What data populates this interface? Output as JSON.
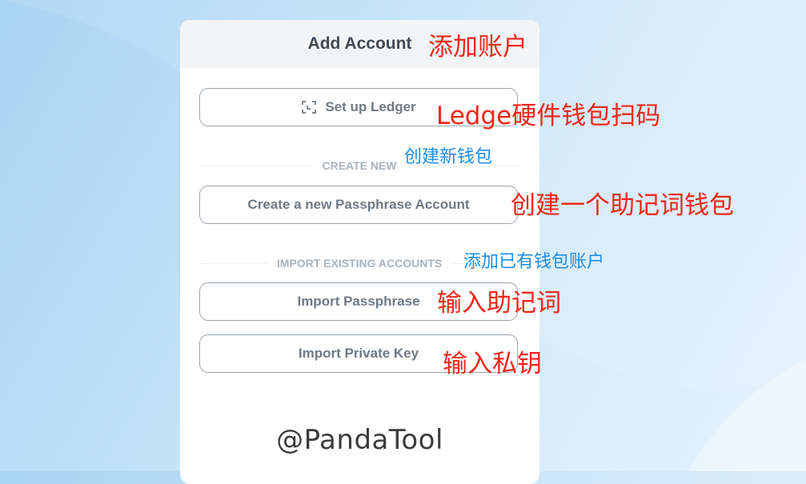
{
  "card": {
    "title": "Add Account"
  },
  "ledger_button": {
    "label": "Set up Ledger",
    "icon": "scan-icon"
  },
  "create_section": {
    "label": "CREATE NEW",
    "button_label": "Create a new Passphrase Account"
  },
  "import_section": {
    "label": "IMPORT EXISTING ACCOUNTS",
    "passphrase_label": "Import Passphrase",
    "private_key_label": "Import Private Key"
  },
  "watermark": "@PandaTool",
  "annotations": {
    "title": "添加账户",
    "ledger": "Ledge硬件钱包扫码",
    "create_new": "创建新钱包",
    "create_passphrase": "创建一个助记词钱包",
    "import_existing": "添加已有钱包账户",
    "import_passphrase": "输入助记词",
    "import_private_key": "输入私钥"
  },
  "colors": {
    "annotation_red": "#f0261a",
    "annotation_blue": "#1c8ee8",
    "button_text": "#6e7a86",
    "section_label": "#a9b3bd"
  }
}
